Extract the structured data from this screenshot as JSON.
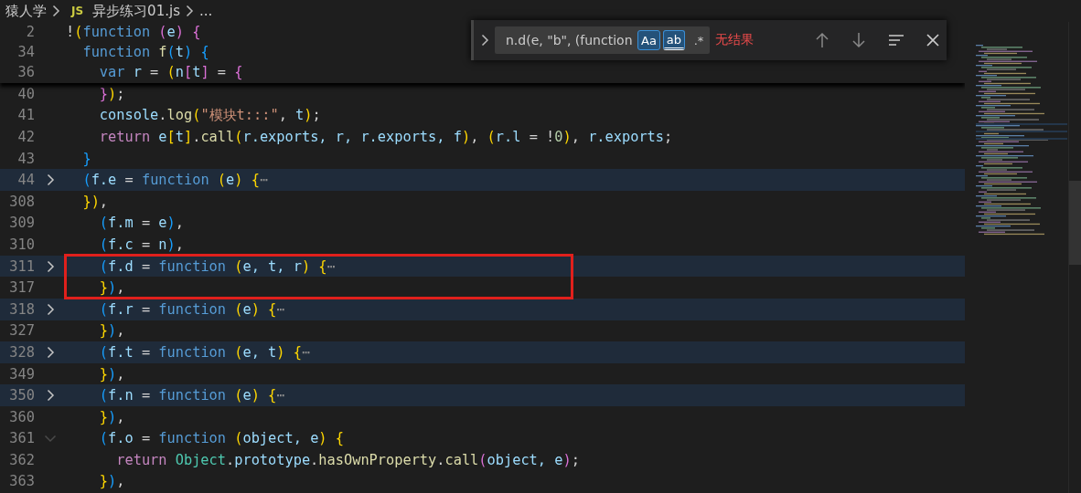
{
  "breadcrumb": {
    "items": [
      {
        "label": "猿人学"
      },
      {
        "label": "异步练习01.js",
        "file_icon": "JS"
      }
    ],
    "tail": "..."
  },
  "sticky_lines": [
    {
      "number": "2",
      "tokens": [
        {
          "text": "!",
          "kind": "plain"
        },
        {
          "text": "(",
          "kind": "bracket1"
        },
        {
          "text": "function ",
          "kind": "keyword"
        },
        {
          "text": "(",
          "kind": "bracket2"
        },
        {
          "text": "e",
          "kind": "variable"
        },
        {
          "text": ") {",
          "kind": "bracket2"
        }
      ]
    },
    {
      "number": "34",
      "tokens": [
        {
          "text": "  function ",
          "kind": "keyword"
        },
        {
          "text": "f",
          "kind": "function"
        },
        {
          "text": "(",
          "kind": "bracket3"
        },
        {
          "text": "t",
          "kind": "variable"
        },
        {
          "text": ") {",
          "kind": "bracket3"
        }
      ]
    },
    {
      "number": "36",
      "tokens": [
        {
          "text": "    var ",
          "kind": "keyword"
        },
        {
          "text": "r",
          "kind": "variable"
        },
        {
          "text": " = ",
          "kind": "plain"
        },
        {
          "text": "(",
          "kind": "bracket1"
        },
        {
          "text": "n",
          "kind": "variable"
        },
        {
          "text": "[",
          "kind": "bracket2"
        },
        {
          "text": "t",
          "kind": "variable"
        },
        {
          "text": "]",
          "kind": "bracket2"
        },
        {
          "text": " = ",
          "kind": "plain"
        },
        {
          "text": "{",
          "kind": "bracket2"
        }
      ]
    }
  ],
  "lines": [
    {
      "number": "40",
      "tokens": [
        {
          "text": "    }",
          "kind": "bracket2"
        },
        {
          "text": ")",
          "kind": "bracket1"
        },
        {
          "text": ";",
          "kind": "plain"
        }
      ]
    },
    {
      "number": "41",
      "tokens": [
        {
          "text": "    console",
          "kind": "variable"
        },
        {
          "text": ".",
          "kind": "plain"
        },
        {
          "text": "log",
          "kind": "function"
        },
        {
          "text": "(",
          "kind": "bracket1"
        },
        {
          "text": "\"模块t:::\"",
          "kind": "string"
        },
        {
          "text": ", ",
          "kind": "plain"
        },
        {
          "text": "t",
          "kind": "variable"
        },
        {
          "text": ")",
          "kind": "bracket1"
        },
        {
          "text": ";",
          "kind": "plain"
        }
      ]
    },
    {
      "number": "42",
      "tokens": [
        {
          "text": "    return ",
          "kind": "control"
        },
        {
          "text": "e",
          "kind": "variable"
        },
        {
          "text": "[",
          "kind": "bracket1"
        },
        {
          "text": "t",
          "kind": "variable"
        },
        {
          "text": "]",
          "kind": "bracket1"
        },
        {
          "text": ".",
          "kind": "plain"
        },
        {
          "text": "call",
          "kind": "function"
        },
        {
          "text": "(",
          "kind": "bracket1"
        },
        {
          "text": "r.exports, r, r.exports, f",
          "kind": "variable"
        },
        {
          "text": ")",
          "kind": "bracket1"
        },
        {
          "text": ", ",
          "kind": "plain"
        },
        {
          "text": "(",
          "kind": "bracket1"
        },
        {
          "text": "r.l",
          "kind": "variable"
        },
        {
          "text": " = !",
          "kind": "plain"
        },
        {
          "text": "0",
          "kind": "number"
        },
        {
          "text": ")",
          "kind": "bracket1"
        },
        {
          "text": ", ",
          "kind": "plain"
        },
        {
          "text": "r.exports",
          "kind": "variable"
        },
        {
          "text": ";",
          "kind": "plain"
        }
      ]
    },
    {
      "number": "43",
      "tokens": [
        {
          "text": "  }",
          "kind": "bracket3"
        }
      ]
    },
    {
      "number": "44",
      "collapsed": true,
      "tokens": [
        {
          "text": "  (",
          "kind": "bracket3"
        },
        {
          "text": "f.e",
          "kind": "variable"
        },
        {
          "text": " = ",
          "kind": "plain"
        },
        {
          "text": "function ",
          "kind": "keyword"
        },
        {
          "text": "(",
          "kind": "bracket1"
        },
        {
          "text": "e",
          "kind": "variable"
        },
        {
          "text": ") {",
          "kind": "bracket1"
        },
        {
          "text": "⋯",
          "kind": "ellipsis"
        }
      ]
    },
    {
      "number": "308",
      "tokens": [
        {
          "text": "  })",
          "kind": "bracket1"
        },
        {
          "text": ",",
          "kind": "plain"
        }
      ]
    },
    {
      "number": "309",
      "tokens": [
        {
          "text": "    (",
          "kind": "bracket3"
        },
        {
          "text": "f.m",
          "kind": "variable"
        },
        {
          "text": " = ",
          "kind": "plain"
        },
        {
          "text": "e",
          "kind": "variable"
        },
        {
          "text": ")",
          "kind": "bracket3"
        },
        {
          "text": ",",
          "kind": "plain"
        }
      ]
    },
    {
      "number": "310",
      "tokens": [
        {
          "text": "    (",
          "kind": "bracket3"
        },
        {
          "text": "f.c",
          "kind": "variable"
        },
        {
          "text": " = ",
          "kind": "plain"
        },
        {
          "text": "n",
          "kind": "variable"
        },
        {
          "text": ")",
          "kind": "bracket3"
        },
        {
          "text": ",",
          "kind": "plain"
        }
      ]
    },
    {
      "number": "311",
      "collapsed": true,
      "tokens": [
        {
          "text": "    (",
          "kind": "bracket3"
        },
        {
          "text": "f.d",
          "kind": "variable"
        },
        {
          "text": " = ",
          "kind": "plain"
        },
        {
          "text": "function ",
          "kind": "keyword"
        },
        {
          "text": "(",
          "kind": "bracket1"
        },
        {
          "text": "e, t, r",
          "kind": "variable"
        },
        {
          "text": ") {",
          "kind": "bracket1"
        },
        {
          "text": "⋯",
          "kind": "ellipsis"
        }
      ]
    },
    {
      "number": "317",
      "tokens": [
        {
          "text": "    }",
          "kind": "bracket1"
        },
        {
          "text": ")",
          "kind": "bracket3"
        },
        {
          "text": ",",
          "kind": "plain"
        }
      ]
    },
    {
      "number": "318",
      "collapsed": true,
      "tokens": [
        {
          "text": "    (",
          "kind": "bracket3"
        },
        {
          "text": "f.r",
          "kind": "variable"
        },
        {
          "text": " = ",
          "kind": "plain"
        },
        {
          "text": "function ",
          "kind": "keyword"
        },
        {
          "text": "(",
          "kind": "bracket1"
        },
        {
          "text": "e",
          "kind": "variable"
        },
        {
          "text": ") {",
          "kind": "bracket1"
        },
        {
          "text": "⋯",
          "kind": "ellipsis"
        }
      ]
    },
    {
      "number": "327",
      "tokens": [
        {
          "text": "    }",
          "kind": "bracket1"
        },
        {
          "text": ")",
          "kind": "bracket3"
        },
        {
          "text": ",",
          "kind": "plain"
        }
      ]
    },
    {
      "number": "328",
      "collapsed": true,
      "tokens": [
        {
          "text": "    (",
          "kind": "bracket3"
        },
        {
          "text": "f.t",
          "kind": "variable"
        },
        {
          "text": " = ",
          "kind": "plain"
        },
        {
          "text": "function ",
          "kind": "keyword"
        },
        {
          "text": "(",
          "kind": "bracket1"
        },
        {
          "text": "e, t",
          "kind": "variable"
        },
        {
          "text": ") {",
          "kind": "bracket1"
        },
        {
          "text": "⋯",
          "kind": "ellipsis"
        }
      ]
    },
    {
      "number": "349",
      "tokens": [
        {
          "text": "    }",
          "kind": "bracket1"
        },
        {
          "text": ")",
          "kind": "bracket3"
        },
        {
          "text": ",",
          "kind": "plain"
        }
      ]
    },
    {
      "number": "350",
      "collapsed": true,
      "tokens": [
        {
          "text": "    (",
          "kind": "bracket3"
        },
        {
          "text": "f.n",
          "kind": "variable"
        },
        {
          "text": " = ",
          "kind": "plain"
        },
        {
          "text": "function ",
          "kind": "keyword"
        },
        {
          "text": "(",
          "kind": "bracket1"
        },
        {
          "text": "e",
          "kind": "variable"
        },
        {
          "text": ") {",
          "kind": "bracket1"
        },
        {
          "text": "⋯",
          "kind": "ellipsis"
        }
      ]
    },
    {
      "number": "360",
      "tokens": [
        {
          "text": "    }",
          "kind": "bracket1"
        },
        {
          "text": ")",
          "kind": "bracket3"
        },
        {
          "text": ",",
          "kind": "plain"
        }
      ]
    },
    {
      "number": "361",
      "collapsed": false,
      "tokens": [
        {
          "text": "    (",
          "kind": "bracket3"
        },
        {
          "text": "f.o",
          "kind": "variable"
        },
        {
          "text": " = ",
          "kind": "plain"
        },
        {
          "text": "function ",
          "kind": "keyword"
        },
        {
          "text": "(",
          "kind": "bracket1"
        },
        {
          "text": "object, e",
          "kind": "variable"
        },
        {
          "text": ") {",
          "kind": "bracket1"
        }
      ]
    },
    {
      "number": "362",
      "tokens": [
        {
          "text": "      return ",
          "kind": "control"
        },
        {
          "text": "Object",
          "kind": "class"
        },
        {
          "text": ".",
          "kind": "plain"
        },
        {
          "text": "prototype",
          "kind": "variable"
        },
        {
          "text": ".",
          "kind": "plain"
        },
        {
          "text": "hasOwnProperty",
          "kind": "function"
        },
        {
          "text": ".",
          "kind": "plain"
        },
        {
          "text": "call",
          "kind": "function"
        },
        {
          "text": "(",
          "kind": "bracket2"
        },
        {
          "text": "object, e",
          "kind": "variable"
        },
        {
          "text": ")",
          "kind": "bracket2"
        },
        {
          "text": ";",
          "kind": "plain"
        }
      ]
    },
    {
      "number": "363",
      "tokens": [
        {
          "text": "    }",
          "kind": "bracket1"
        },
        {
          "text": ")",
          "kind": "bracket3"
        },
        {
          "text": ",",
          "kind": "plain"
        }
      ]
    }
  ],
  "find_widget": {
    "value": "n.d(e, \"b\", (function",
    "options": [
      {
        "kind": "case",
        "label": "Aa",
        "on": true
      },
      {
        "kind": "word",
        "label": "ab",
        "on": true
      },
      {
        "kind": "regex",
        "label": ".*",
        "on": false
      }
    ],
    "status": "无结果"
  }
}
